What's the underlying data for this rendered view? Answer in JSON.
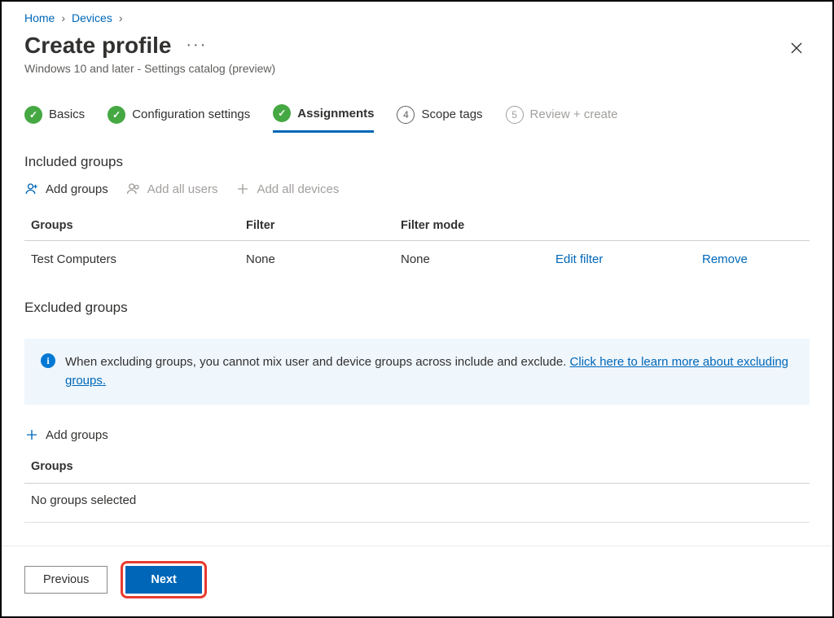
{
  "breadcrumb": {
    "items": [
      "Home",
      "Devices"
    ]
  },
  "header": {
    "title": "Create profile",
    "subtitle": "Windows 10 and later - Settings catalog (preview)"
  },
  "stepper": {
    "steps": [
      {
        "label": "Basics",
        "state": "done"
      },
      {
        "label": "Configuration settings",
        "state": "done"
      },
      {
        "label": "Assignments",
        "state": "active"
      },
      {
        "label": "Scope tags",
        "num": "4",
        "state": "pending"
      },
      {
        "label": "Review + create",
        "num": "5",
        "state": "dim"
      }
    ]
  },
  "included": {
    "title": "Included groups",
    "actions": {
      "add_groups": "Add groups",
      "add_all_users": "Add all users",
      "add_all_devices": "Add all devices"
    },
    "columns": {
      "groups": "Groups",
      "filter": "Filter",
      "mode": "Filter mode"
    },
    "row": {
      "group": "Test Computers",
      "filter": "None",
      "mode": "None",
      "edit": "Edit filter",
      "remove": "Remove"
    }
  },
  "excluded": {
    "title": "Excluded groups",
    "info_text": "When excluding groups, you cannot mix user and device groups across include and exclude. ",
    "info_link": "Click here to learn more about excluding groups.",
    "add_groups": "Add groups",
    "groups_heading": "Groups",
    "empty": "No groups selected"
  },
  "footer": {
    "previous": "Previous",
    "next": "Next"
  }
}
